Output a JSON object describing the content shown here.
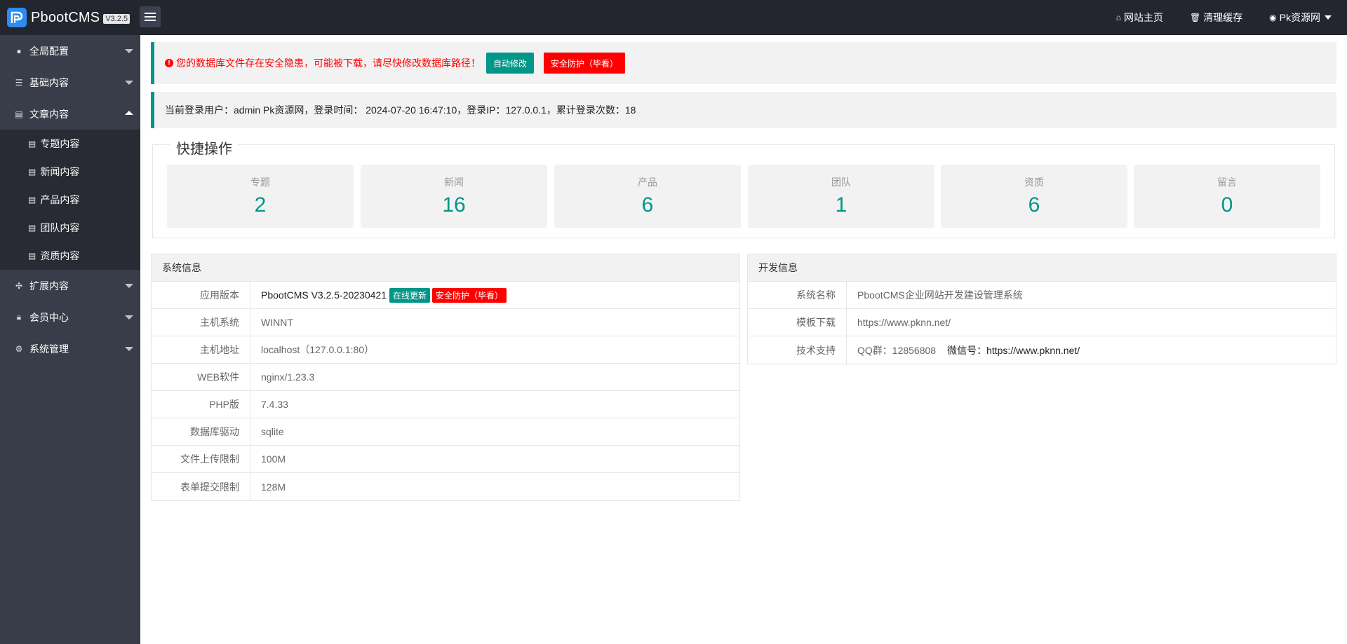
{
  "header": {
    "logo_text": "PbootCMS",
    "version": "V3.2.5",
    "nav": [
      {
        "icon": "home-icon",
        "label": "网站主页"
      },
      {
        "icon": "trash-icon",
        "label": "清理缓存"
      },
      {
        "icon": "user-icon",
        "label": "Pk资源网"
      }
    ]
  },
  "sidebar": {
    "groups": [
      {
        "label": "全局配置",
        "icon": "globe-icon"
      },
      {
        "label": "基础内容",
        "icon": "sliders-icon"
      },
      {
        "label": "文章内容",
        "icon": "file-icon",
        "expanded": true
      },
      {
        "label": "扩展内容",
        "icon": "expand-icon"
      },
      {
        "label": "会员中心",
        "icon": "lock-icon"
      },
      {
        "label": "系统管理",
        "icon": "gear-icon"
      }
    ],
    "sub_items": [
      "专题内容",
      "新闻内容",
      "产品内容",
      "团队内容",
      "资质内容"
    ]
  },
  "alerts": {
    "warning_text": "您的数据库文件存在安全隐患，可能被下载，请尽快修改数据库路径！",
    "auto_fix_label": "自动修改",
    "security_label": "安全防护（毕看）",
    "login_info": "当前登录用户：admin Pk资源网，登录时间： 2024-07-20 16:47:10，登录IP：127.0.0.1，累计登录次数：18"
  },
  "quick": {
    "title": "快捷操作",
    "stats": [
      {
        "label": "专题",
        "value": "2"
      },
      {
        "label": "新闻",
        "value": "16"
      },
      {
        "label": "产品",
        "value": "6"
      },
      {
        "label": "团队",
        "value": "1"
      },
      {
        "label": "资质",
        "value": "6"
      },
      {
        "label": "留言",
        "value": "0"
      }
    ]
  },
  "sysinfo": {
    "title": "系统信息",
    "rows": [
      {
        "label": "应用版本",
        "value": "PbootCMS V3.2.5-20230421"
      },
      {
        "label": "主机系统",
        "value": "WINNT"
      },
      {
        "label": "主机地址",
        "value": "localhost（127.0.0.1:80）"
      },
      {
        "label": "WEB软件",
        "value": "nginx/1.23.3"
      },
      {
        "label": "PHP版",
        "value": "7.4.33"
      },
      {
        "label": "数据库驱动",
        "value": "sqlite"
      },
      {
        "label": "文件上传限制",
        "value": "100M"
      },
      {
        "label": "表单提交限制",
        "value": "128M"
      }
    ],
    "update_tag": "在线更新",
    "security_tag": "安全防护（毕看）"
  },
  "devinfo": {
    "title": "开发信息",
    "rows": [
      {
        "label": "系统名称",
        "value": "PbootCMS企业网站开发建设管理系统"
      },
      {
        "label": "模板下载",
        "value": "https://www.pknn.net/"
      },
      {
        "label": "技术支持",
        "value": "QQ群：12856808",
        "extra_label": "微信号：",
        "extra_value": "https://www.pknn.net/"
      }
    ]
  },
  "colors": {
    "accent": "#009688",
    "danger": "#ff0000",
    "header_bg": "#23262e",
    "sidebar_bg": "#393d49"
  }
}
